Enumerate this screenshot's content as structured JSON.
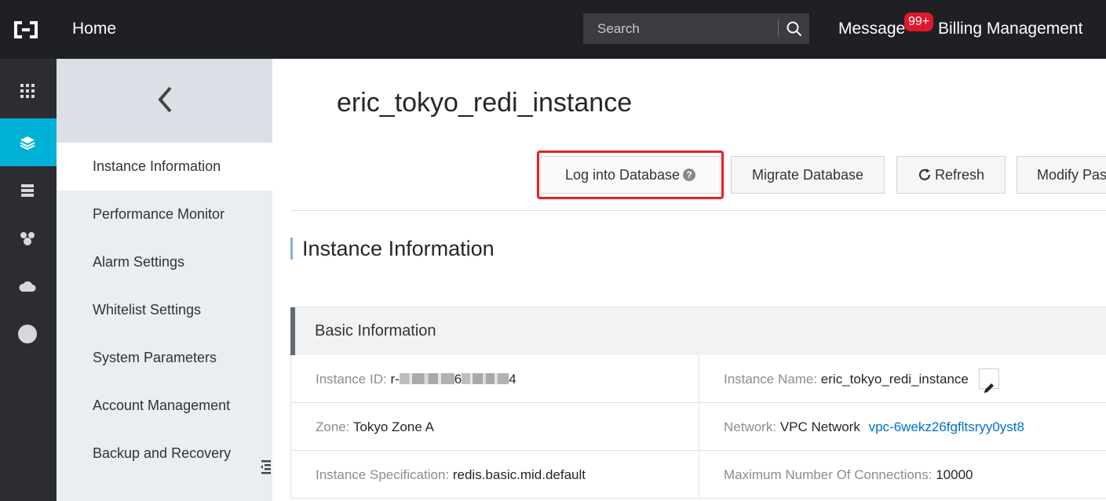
{
  "topbar": {
    "home_label": "Home",
    "search_placeholder": "Search",
    "message_label": "Message",
    "message_badge": "99+",
    "billing_label": "Billing Management"
  },
  "rail": {
    "items": [
      {
        "icon": "grid-icon"
      },
      {
        "icon": "layers-icon",
        "active": true
      },
      {
        "icon": "server-stack-icon"
      },
      {
        "icon": "cluster-icon"
      },
      {
        "icon": "cloud-icon"
      },
      {
        "icon": "circle-icon"
      }
    ]
  },
  "subnav": {
    "items": [
      {
        "label": "Instance Information",
        "active": true
      },
      {
        "label": "Performance Monitor"
      },
      {
        "label": "Alarm Settings"
      },
      {
        "label": "Whitelist Settings"
      },
      {
        "label": "System Parameters"
      },
      {
        "label": "Account Management"
      },
      {
        "label": "Backup and Recovery"
      }
    ]
  },
  "main": {
    "title": "eric_tokyo_redi_instance",
    "buttons": {
      "login": "Log into Database",
      "migrate": "Migrate Database",
      "refresh": "Refresh",
      "modify": "Modify Pas"
    },
    "section_title": "Instance Information",
    "basic": {
      "header": "Basic Information",
      "rows": [
        [
          {
            "label": "Instance ID:",
            "value_prefix": "r-",
            "value_mid": "6",
            "value_suffix": "4"
          },
          {
            "label": "Instance Name:",
            "value": "eric_tokyo_redi_instance"
          }
        ],
        [
          {
            "label": "Zone:",
            "value": "Tokyo Zone A"
          },
          {
            "label": "Network:",
            "value": "VPC Network",
            "link": "vpc-6wekz26fgfltsryy0yst8"
          }
        ],
        [
          {
            "label": "Instance Specification:",
            "value": "redis.basic.mid.default"
          },
          {
            "label": "Maximum Number Of Connections:",
            "value": "10000"
          }
        ]
      ]
    }
  },
  "colors": {
    "topbar_bg": "#1f2024",
    "rail_bg": "#2b2d33",
    "rail_active": "#00b1d6",
    "badge": "#e0182e",
    "highlight_outline": "#e1232d",
    "link": "#0070cc"
  }
}
